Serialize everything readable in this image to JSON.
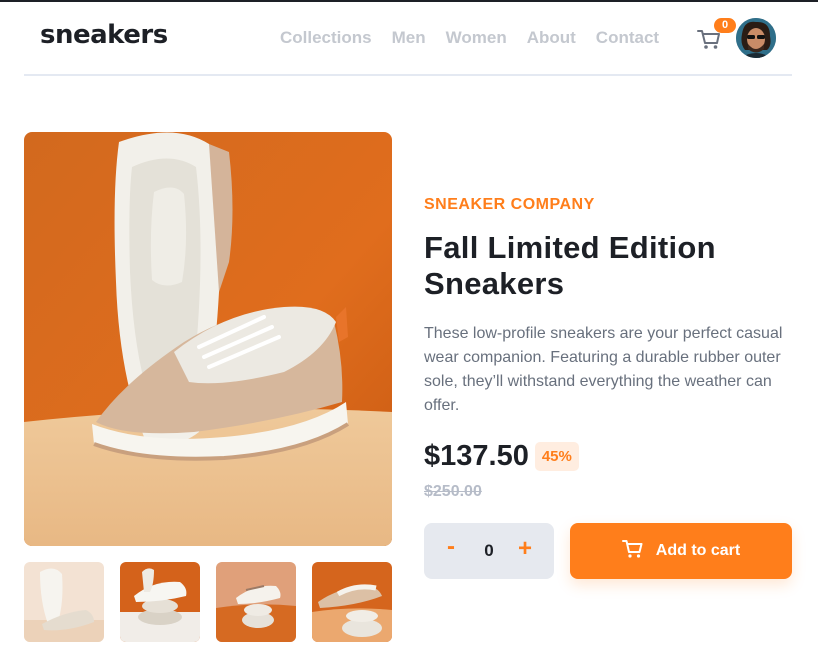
{
  "brand": {
    "logo": "sneakers"
  },
  "nav": {
    "items": [
      "Collections",
      "Men",
      "Women",
      "About",
      "Contact"
    ]
  },
  "cart": {
    "count": "0",
    "icon": "cart-icon"
  },
  "user": {
    "avatar": "avatar"
  },
  "product": {
    "company": "SNEAKER COMPANY",
    "title": "Fall Limited Edition Sneakers",
    "description": "These low-profile sneakers are your perfect casual wear companion. Featuring a durable rubber outer sole, they’ll withstand everything the weather can offer.",
    "price": "$137.50",
    "discount": "45%",
    "old_price": "$250.00"
  },
  "quantity": {
    "minus": "-",
    "value": "0",
    "plus": "+"
  },
  "actions": {
    "add_to_cart": "Add to cart"
  },
  "colors": {
    "accent": "#ff7e1b",
    "accent_pale": "#ffede0",
    "text": "#1d2026",
    "muted": "#68707d"
  }
}
